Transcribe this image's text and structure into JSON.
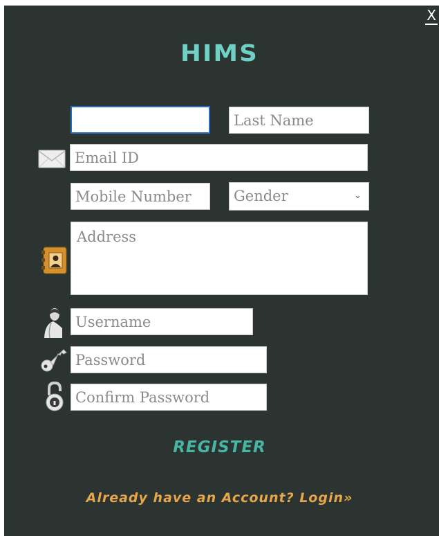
{
  "window": {
    "close_label": "X"
  },
  "app": {
    "logo": "HIMS"
  },
  "form": {
    "first_name": {
      "value": "",
      "placeholder": ""
    },
    "last_name": {
      "placeholder": "Last Name"
    },
    "email": {
      "placeholder": "Email ID"
    },
    "mobile": {
      "placeholder": "Mobile Number"
    },
    "gender": {
      "selected": "Gender"
    },
    "address": {
      "placeholder": "Address"
    },
    "username": {
      "placeholder": "Username"
    },
    "password": {
      "placeholder": "Password"
    },
    "confirm_password": {
      "placeholder": "Confirm Password"
    }
  },
  "actions": {
    "register_label": "REGISTER",
    "login_link": "Already have an Account? Login»"
  },
  "icons": {
    "email": "envelope-icon",
    "address": "address-book-icon",
    "username": "user-icon",
    "password": "key-icon",
    "confirm_password": "padlock-icon"
  },
  "colors": {
    "background": "#2c3431",
    "logo": "#6fd1c6",
    "register": "#4bb3a3",
    "login_link": "#e8a64a",
    "focus_border": "#2b6cc6"
  }
}
